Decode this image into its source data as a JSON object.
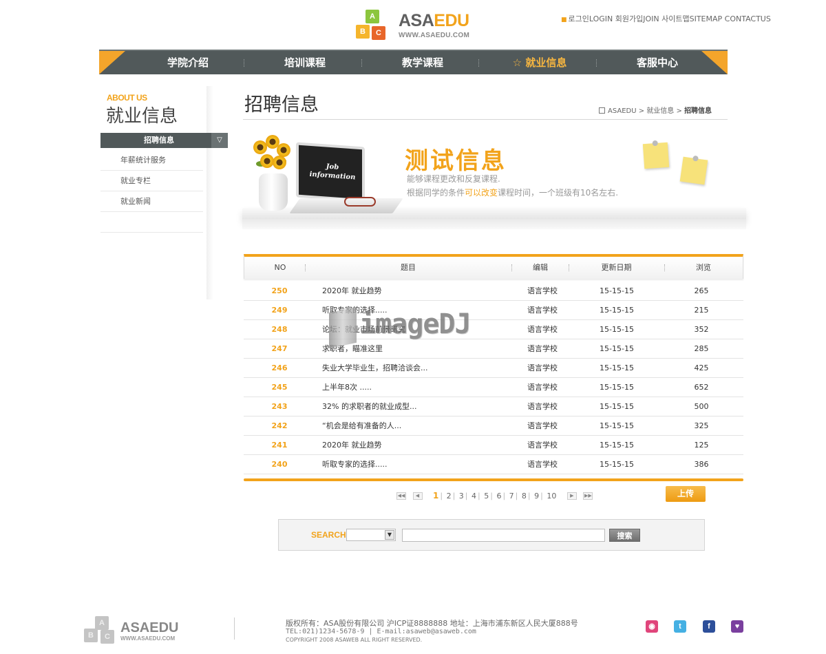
{
  "header": {
    "logo_main": "ASA",
    "logo_accent": "EDU",
    "logo_url": "WWW.ASAEDU.COM",
    "logo_blocks": [
      "A",
      "B",
      "C"
    ],
    "top_links": "로그인LOGIN 회원가입JOIN 사이트맵SITEMAP CONTACTUS"
  },
  "nav": {
    "items": [
      "学院介绍",
      "培训课程",
      "教学课程",
      "就业信息",
      "客服中心"
    ],
    "active_index": 3,
    "active_icon": "star-icon"
  },
  "sidebar": {
    "about_label": "ABOUT US",
    "title": "就业信息",
    "active_item": "招聘信息",
    "items": [
      "年薪统计服务",
      "就业专栏",
      "就业新闻"
    ]
  },
  "main": {
    "title": "招聘信息",
    "breadcrumb": [
      "ASAEDU",
      "就业信息",
      "招聘信息"
    ]
  },
  "banner": {
    "laptop_text": "Job information",
    "headline": "测试信息",
    "line1": "能够课程更改和反复课程.",
    "line2_prefix": "根据同学的条件",
    "line2_highlight": "可以改变",
    "line2_suffix": "课程时间，一个班级有10名左右."
  },
  "table": {
    "columns": [
      "NO",
      "题目",
      "编辑",
      "更新日期",
      "浏览"
    ],
    "rows": [
      {
        "no": "250",
        "title": "2020年 就业趋势",
        "editor": "语言学校",
        "date": "15-15-15",
        "views": "265"
      },
      {
        "no": "249",
        "title": "听取专家的选择.....",
        "editor": "语言学校",
        "date": "15-15-15",
        "views": "215"
      },
      {
        "no": "248",
        "title": "论坛：就业市场前景研究",
        "editor": "语言学校",
        "date": "15-15-15",
        "views": "352"
      },
      {
        "no": "247",
        "title": "求职者，瞄准这里",
        "editor": "语言学校",
        "date": "15-15-15",
        "views": "285"
      },
      {
        "no": "246",
        "title": "失业大学毕业生，招聘洽谈会...",
        "editor": "语言学校",
        "date": "15-15-15",
        "views": "425"
      },
      {
        "no": "245",
        "title": "上半年8次 .....",
        "editor": "语言学校",
        "date": "15-15-15",
        "views": "652"
      },
      {
        "no": "243",
        "title": "32% 的求职者的就业成型...",
        "editor": "语言学校",
        "date": "15-15-15",
        "views": "500"
      },
      {
        "no": "242",
        "title": "“机会是给有准备的人...",
        "editor": "语言学校",
        "date": "15-15-15",
        "views": "325"
      },
      {
        "no": "241",
        "title": "2020年 就业趋势",
        "editor": "语言学校",
        "date": "15-15-15",
        "views": "125"
      },
      {
        "no": "240",
        "title": "听取专家的选择.....",
        "editor": "语言学校",
        "date": "15-15-15",
        "views": "386"
      }
    ]
  },
  "pagination": {
    "pages": [
      "1",
      "2",
      "3",
      "4",
      "5",
      "6",
      "7",
      "8",
      "9",
      "10"
    ],
    "current": "1",
    "first_icon": "double-chevron-left-icon",
    "prev_icon": "chevron-left-icon",
    "next_icon": "chevron-right-icon",
    "last_icon": "double-chevron-right-icon",
    "upload_label": "上传"
  },
  "search": {
    "label": "SEARCH",
    "select_value": "",
    "input_value": "",
    "button_label": "搜索"
  },
  "footer": {
    "logo_text": "ASAEDU",
    "logo_url": "WWW.ASAEDU.COM",
    "line1": "版权所有：ASA股份有限公司 沪ICP证8888888 地址：上海市浦东新区人民大厦888号",
    "line2": "TEL:021)1234-5678-9 | E-mail:asaweb@asaweb.com",
    "line3": "COPYRIGHT 2008 ASAWEB ALL RIGHT RESERVED.",
    "social_icons": [
      "cyworld-icon",
      "twitter-icon",
      "facebook-icon",
      "me2day-icon"
    ],
    "social_colors": [
      "#e0457b",
      "#45b0e3",
      "#2d4f9a",
      "#7a3f9e"
    ]
  },
  "watermark": "imageDJ",
  "colors": {
    "accent": "#f2a31b",
    "nav_bg": "#51595a"
  }
}
